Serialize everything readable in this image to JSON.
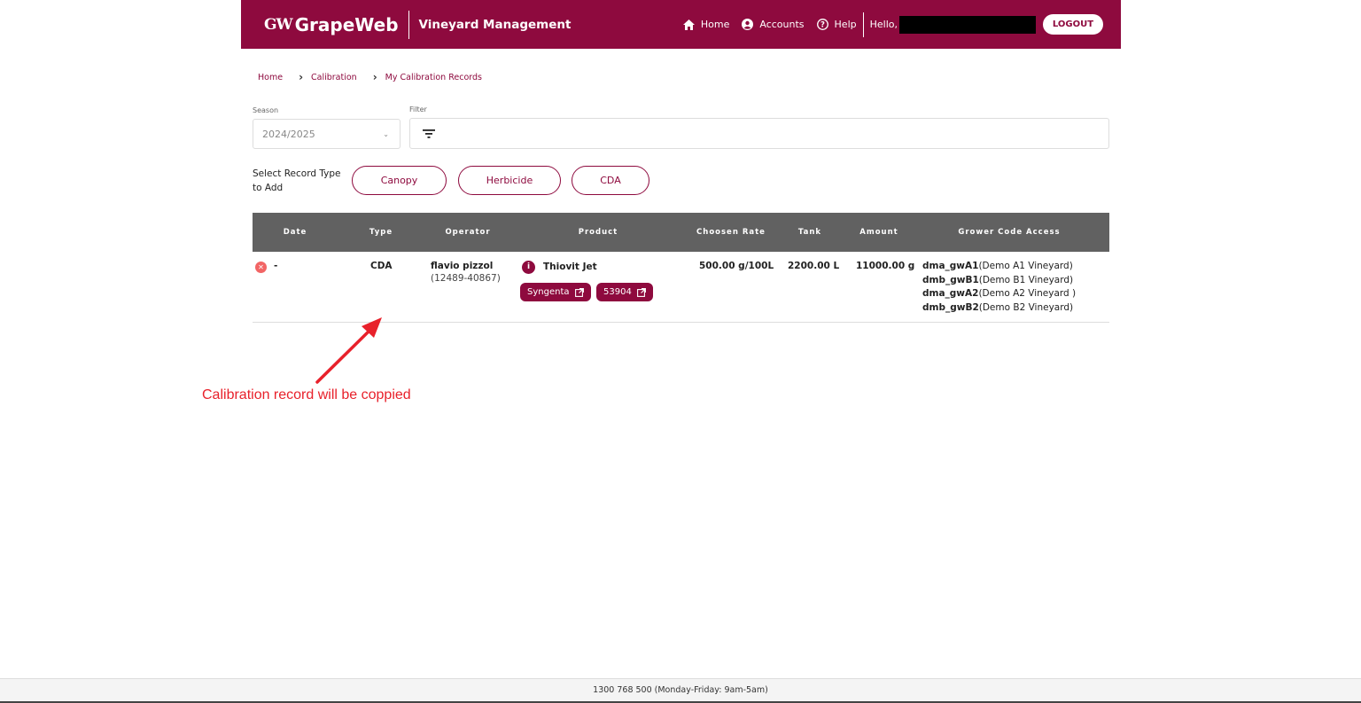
{
  "header": {
    "logo_mark": "GW",
    "logo_text": "GrapeWeb",
    "app_title": "Vineyard Management",
    "nav": [
      {
        "label": "Home",
        "icon": "home-icon"
      },
      {
        "label": "Accounts",
        "icon": "account-icon"
      },
      {
        "label": "Help",
        "icon": "help-icon"
      }
    ],
    "hello": "Hello,",
    "logout_label": "LOGOUT",
    "brand_color": "#8e0a3e"
  },
  "breadcrumb": [
    "Home",
    "Calibration",
    "My Calibration Records"
  ],
  "filters": {
    "season_label": "Season",
    "season_value": "2024/2025",
    "filter_label": "Filter",
    "filter_value": ""
  },
  "record_type": {
    "label_line1": "Select Record Type",
    "label_line2": "to Add",
    "buttons": [
      "Canopy",
      "Herbicide",
      "CDA"
    ]
  },
  "table": {
    "columns": [
      "Date",
      "Type",
      "Operator",
      "Product",
      "Choosen Rate",
      "Tank",
      "Amount Used",
      "Grower Code Access"
    ],
    "rows": [
      {
        "date": "-",
        "type": "CDA",
        "operator_name": "flavio pizzol",
        "operator_id": "(12489-40867)",
        "product": "Thiovit Jet",
        "product_tags": [
          "Syngenta",
          "53904"
        ],
        "rate": "500.00 g/100L",
        "tank": "2200.00 L",
        "amount_used": "11000.00 g",
        "grower_codes": [
          {
            "code": "dma_gwA1",
            "name": "(Demo A1 Vineyard)"
          },
          {
            "code": "dmb_gwB1",
            "name": "(Demo B1 Vineyard)"
          },
          {
            "code": "dma_gwA2",
            "name": "(Demo A2 Vineyard )"
          },
          {
            "code": "dmb_gwB2",
            "name": "(Demo B2 Vineyard)"
          }
        ]
      }
    ]
  },
  "annotation": {
    "text": "Calibration record will be coppied",
    "color": "#e8212b"
  },
  "footer": {
    "text": "1300 768 500 (Monday-Friday: 9am-5am)"
  }
}
